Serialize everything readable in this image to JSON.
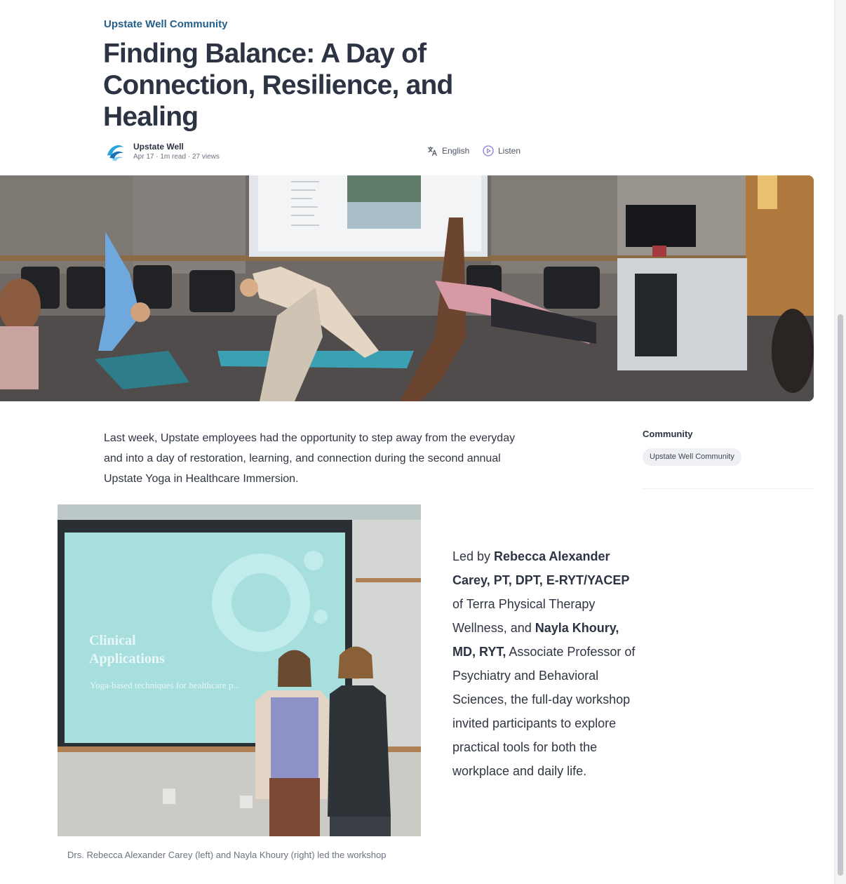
{
  "article": {
    "community_link": "Upstate Well Community",
    "title": "Finding Balance: A Day of Connection, Resilience, and Healing",
    "author": "Upstate Well",
    "date": "Apr 17",
    "read_time": "1m read",
    "views": "27 views",
    "meta_separator": "·",
    "language_label": "English",
    "listen_label": "Listen",
    "intro": "Last week, Upstate employees had the opportunity to step away from the everyday and into a day of restoration, learning, and connection during the second annual Upstate Yoga in Healthcare Immersion.",
    "body": {
      "p1": "Led by ",
      "b1": "Rebecca Alexander Carey, PT, DPT, E-RYT/YACEP",
      "p2": " of Terra Physical Therapy Wellness, and ",
      "b2": "Nayla Khoury, MD, RYT,",
      "p3": " Associate Professor of Psychiatry and Behavioral Sciences, the full-day workshop invited participants to explore practical tools for both the workplace and daily life."
    },
    "photo_caption": "Drs. Rebecca Alexander Carey (left) and Nayla Khoury (right) led the workshop",
    "slide_title": "Clinical Applications",
    "slide_subtitle": "Yoga-based techniques for healthcare p..."
  },
  "sidebar": {
    "heading": "Community",
    "tag": "Upstate Well Community"
  },
  "icons": {
    "translate": "translate-icon",
    "listen": "play-circle-icon",
    "logo": "upstate-well-logo"
  },
  "colors": {
    "accent": "#25608c",
    "title": "#2c3342",
    "muted": "#6b7280",
    "tag_bg": "#eef0f3"
  }
}
